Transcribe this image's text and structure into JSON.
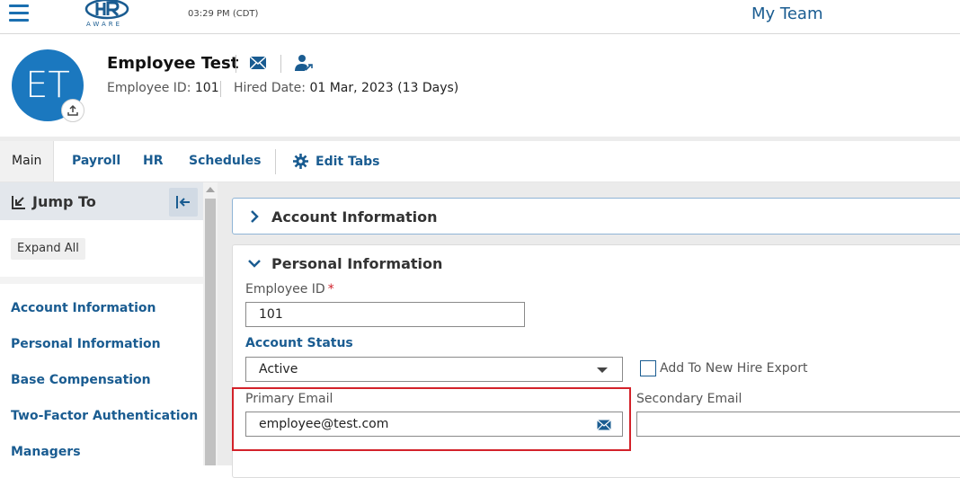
{
  "topbar": {
    "logo_text": "AWARE",
    "time": "03:29 PM (CDT)",
    "section_title": "My Team"
  },
  "employee": {
    "initials": "ET",
    "name": "Employee Test",
    "id_label": "Employee ID:",
    "id_value": "101",
    "hired_label": "Hired Date:",
    "hired_value": "01 Mar, 2023 (13 Days)"
  },
  "tabs": {
    "items": [
      "Main",
      "Payroll",
      "HR",
      "Schedules"
    ],
    "edit_label": "Edit Tabs"
  },
  "sidebar": {
    "title": "Jump To",
    "expand_all": "Expand All",
    "links": [
      "Account Information",
      "Personal Information",
      "Base Compensation",
      "Two-Factor Authentication",
      "Managers"
    ]
  },
  "sections": {
    "account_info": "Account Information",
    "personal_info": "Personal Information"
  },
  "form": {
    "employee_id_label": "Employee ID",
    "required_mark": "*",
    "employee_id_value": "101",
    "account_status_label": "Account Status",
    "account_status_value": "Active",
    "new_hire_export_label": "Add To New Hire Export",
    "primary_email_label": "Primary Email",
    "primary_email_value": "employee@test.com",
    "secondary_email_label": "Secondary Email",
    "secondary_email_value": ""
  },
  "colors": {
    "accent": "#1a5c91",
    "avatar": "#1b78bf",
    "highlight": "#d3222a"
  },
  "icons": [
    "hamburger-icon",
    "mail-icon",
    "person-link-icon",
    "upload-icon",
    "gear-icon",
    "jump-to-icon",
    "collapse-left-icon",
    "chevron-right-icon",
    "chevron-down-icon",
    "select-caret-icon",
    "email-icon"
  ]
}
